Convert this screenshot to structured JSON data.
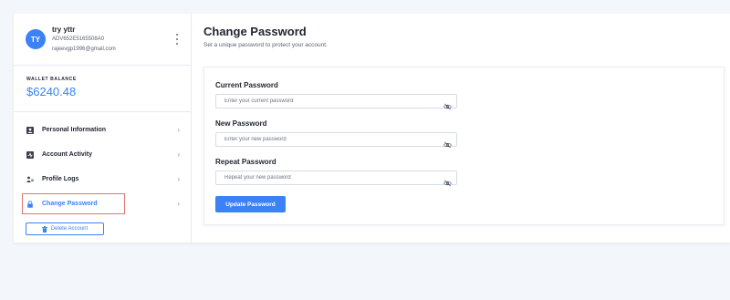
{
  "profile": {
    "initials": "TY",
    "name": "try yttr",
    "account_id": "ADV652E5165508A0",
    "email": "rajeevgp1996@gmail.com"
  },
  "wallet": {
    "label": "WALLET BALANCE",
    "value": "$6240.48"
  },
  "menu": {
    "items": [
      {
        "label": "Personal Information",
        "icon": "user-icon"
      },
      {
        "label": "Account Activity",
        "icon": "activity-icon"
      },
      {
        "label": "Profile Logs",
        "icon": "logs-icon"
      },
      {
        "label": "Change Password",
        "icon": "lock-icon",
        "active": true
      }
    ],
    "delete_label": "Delete Account"
  },
  "main": {
    "title": "Change Password",
    "subtitle": "Set a unique password to protect your account.",
    "fields": {
      "current": {
        "label": "Current Password",
        "placeholder": "Enter your current password"
      },
      "new": {
        "label": "New Password",
        "placeholder": "Enter your new password"
      },
      "repeat": {
        "label": "Repeat Password",
        "placeholder": "Repeat your new password"
      }
    },
    "submit_label": "Update Password"
  },
  "colors": {
    "accent": "#3b82f6",
    "highlight_outline": "#e57373",
    "background": "#f3f6fa"
  }
}
